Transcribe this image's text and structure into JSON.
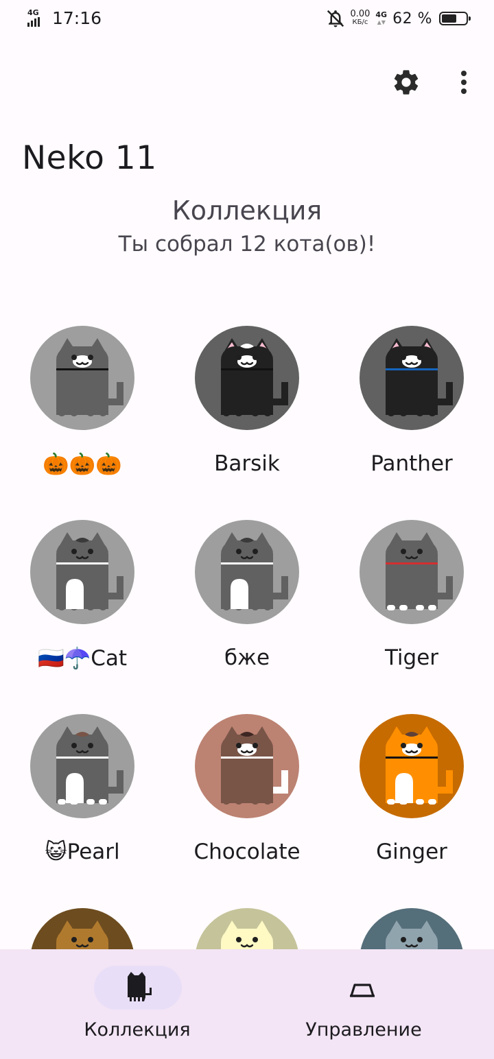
{
  "status_bar": {
    "network": "4G",
    "time": "17:16",
    "data_speed": "0.00",
    "data_unit": "КБ/с",
    "network2": "4G",
    "battery_percent": "62 %",
    "battery_level": 0.62
  },
  "toolbar": {
    "settings_icon": "gear-icon",
    "menu_icon": "more-vert-icon"
  },
  "app": {
    "title": "Neko 11"
  },
  "collection": {
    "title": "Коллекция",
    "subtitle": "Ты собрал 12 кота(ов)!"
  },
  "cats": [
    {
      "name": "🎃🎃🎃",
      "bg": "#9e9e9e",
      "body": "#616161",
      "face": "white",
      "collar": "#111111",
      "ears": "#616161",
      "belly": "",
      "feet": "",
      "tail": "",
      "cap": ""
    },
    {
      "name": "Barsik",
      "bg": "#616161",
      "body": "#212121",
      "face": "white",
      "collar": "#111111",
      "ears": "#f8bbd0",
      "belly": "",
      "feet": "",
      "tail": "",
      "cap": "white"
    },
    {
      "name": "Panther",
      "bg": "#616161",
      "body": "#212121",
      "face": "white",
      "collar": "#1565c0",
      "ears": "#f8bbd0",
      "belly": "",
      "feet": "",
      "tail": "",
      "cap": ""
    },
    {
      "name": "🇷🇺☂️Cat",
      "bg": "#9e9e9e",
      "body": "#616161",
      "face": "",
      "collar": "#ffffff",
      "ears": "#616161",
      "belly": "#ffffff",
      "feet": "",
      "tail": "",
      "cap": "#3a3a3a"
    },
    {
      "name": "бже",
      "bg": "#9e9e9e",
      "body": "#616161",
      "face": "",
      "collar": "#ffffff",
      "ears": "#616161",
      "belly": "#ffffff",
      "feet": "",
      "tail": "",
      "cap": "#3a3a3a"
    },
    {
      "name": "Tiger",
      "bg": "#9e9e9e",
      "body": "#616161",
      "face": "",
      "collar": "#d32f2f",
      "ears": "#616161",
      "belly": "",
      "feet": "#ffffff",
      "tail": "",
      "cap": ""
    },
    {
      "name": "😺Pearl",
      "bg": "#9e9e9e",
      "body": "#616161",
      "face": "",
      "collar": "#ffffff",
      "ears": "#616161",
      "belly": "#ffffff",
      "feet": "#ffffff",
      "tail": "",
      "cap": "#795548"
    },
    {
      "name": "Chocolate",
      "bg": "#bc8272",
      "body": "#795548",
      "face": "white",
      "collar": "#ffffff",
      "ears": "#795548",
      "belly": "",
      "feet": "",
      "tail": "#ffffff",
      "cap": "#3e2723"
    },
    {
      "name": "Ginger",
      "bg": "#c66b00",
      "body": "#ff8f00",
      "face": "white",
      "collar": "#111111",
      "ears": "#ff8f00",
      "belly": "#ffffff",
      "feet": "#ffffff",
      "tail": "",
      "cap": "#5d4037"
    },
    {
      "name": "",
      "bg": "#6d4c1f",
      "body": "#b07a2e",
      "face": "",
      "collar": "",
      "ears": "#b07a2e",
      "belly": "",
      "feet": "",
      "tail": "",
      "cap": ""
    },
    {
      "name": "",
      "bg": "#c5c39a",
      "body": "#fff9c4",
      "face": "",
      "collar": "",
      "ears": "#fff9c4",
      "belly": "",
      "feet": "",
      "tail": "",
      "cap": ""
    },
    {
      "name": "",
      "bg": "#546e7a",
      "body": "#90a4ae",
      "face": "",
      "collar": "",
      "ears": "#90a4ae",
      "belly": "",
      "feet": "",
      "tail": "",
      "cap": ""
    }
  ],
  "bottom_nav": {
    "items": [
      {
        "label": "Коллекция",
        "icon": "cat-icon",
        "selected": true
      },
      {
        "label": "Управление",
        "icon": "food-bowl-icon",
        "selected": false
      }
    ]
  },
  "colors": {
    "background": "#fffbfe",
    "nav_background": "#f3e5f5",
    "nav_pill": "#e8def8"
  }
}
